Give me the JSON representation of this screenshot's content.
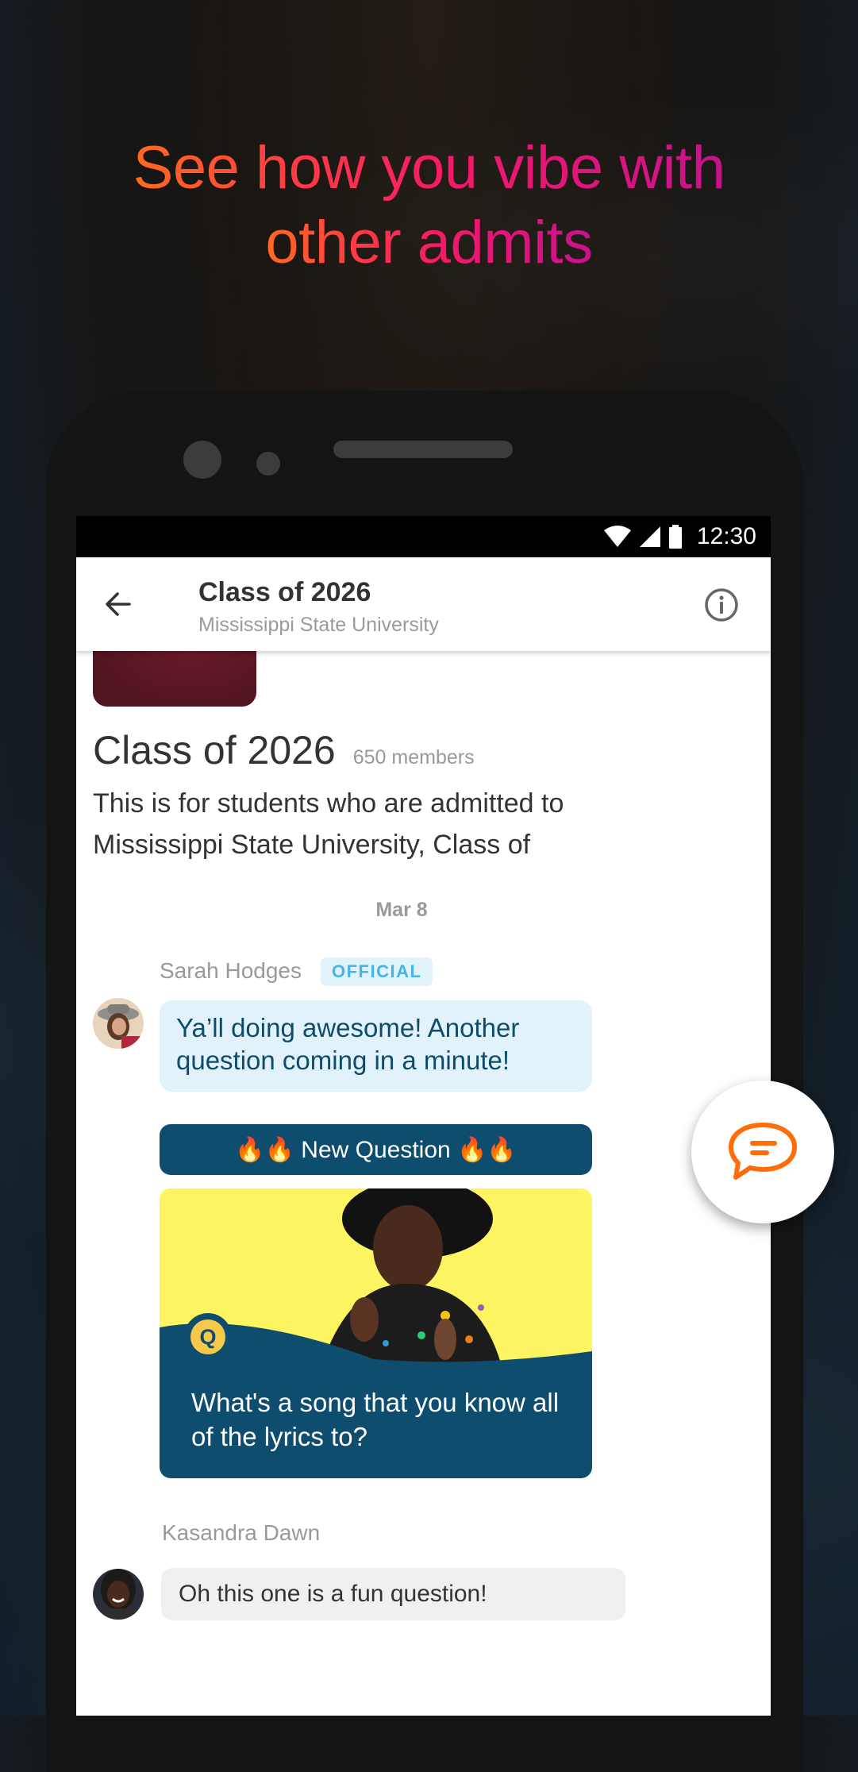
{
  "promo": {
    "headline_line1": "See how you vibe with",
    "headline_line2": "other admits"
  },
  "status_bar": {
    "time": "12:30",
    "icons": [
      "wifi-icon",
      "signal-icon",
      "battery-icon"
    ]
  },
  "app_bar": {
    "back_icon": "arrow-left-icon",
    "title": "Class of 2026",
    "subtitle": "Mississippi State University",
    "info_icon": "info-icon"
  },
  "group": {
    "name": "Class of 2026",
    "members": "650 members",
    "description": "This is for students who are admitted to Mississippi State University, Class of"
  },
  "chat": {
    "date_separator": "Mar 8",
    "messages": [
      {
        "sender": "Sarah Hodges",
        "badge": "OFFICIAL",
        "text": "Ya’ll doing awesome! Another question coming in a minute!"
      },
      {
        "banner": "🔥🔥 New Question 🔥🔥",
        "question_badge": "Q",
        "question": "What's a song that you know all of the lyrics to?"
      },
      {
        "sender": "Kasandra Dawn",
        "text": "Oh this one is a fun question!"
      }
    ]
  },
  "fab": {
    "icon": "chat-bubble-icon"
  },
  "colors": {
    "accent_orange": "#ff6d0a",
    "official_bubble": "#e1f2fb",
    "official_badge_text": "#46b4e4",
    "question_navy": "#0f4d6e",
    "question_yellow": "#fcf561",
    "university_maroon": "#5d1725"
  }
}
